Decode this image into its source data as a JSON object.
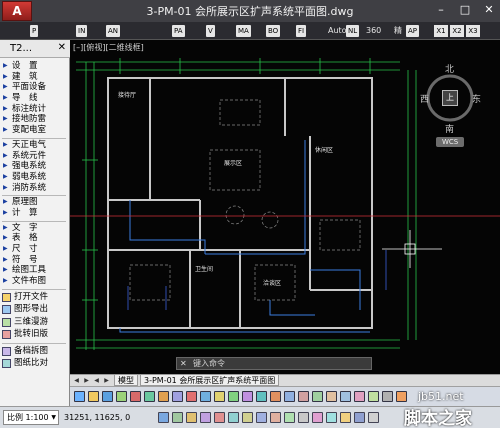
{
  "titlebar": {
    "title": "3-PM-01 会所展示区扩声系统平面图.dwg",
    "minimize": "–",
    "restore": "□",
    "close": "✕",
    "logo": "A"
  },
  "ribbon": {
    "items": [
      "P",
      "IN",
      "AN",
      "PA",
      "V",
      "MA",
      "BO",
      "FI"
    ],
    "auto_label": "Auto",
    "nl_tag": "NL",
    "deg": "360",
    "jing": "精",
    "ap_tag": "AP",
    "x1": "X1",
    "x2": "X2",
    "x3": "X3"
  },
  "panel": {
    "title": "T2...",
    "close": "✕",
    "group1": [
      "设　置",
      "建　筑",
      "平面设备",
      "导　线",
      "标注统计",
      "接地防雷",
      "变配电室"
    ],
    "group2": [
      "天正电气",
      "系统元件",
      "强电系统",
      "弱电系统",
      "消防系统"
    ],
    "group3": [
      "原理图",
      "计　算"
    ],
    "group4": [
      "文　字",
      "表　格",
      "尺　寸",
      "符　号",
      "绘图工具",
      "文件布图"
    ],
    "group5": [
      "打开文件",
      "图形导出",
      "三维漫游",
      "批转旧版"
    ],
    "group6": [
      "备档拆图",
      "图纸比对"
    ]
  },
  "canvas": {
    "view_label": "[–][俯视][二维线框]",
    "compass": {
      "north": "北",
      "south": "南",
      "west": "西",
      "east": "东",
      "center": "上"
    },
    "wcs": "WCS",
    "room_labels": [
      "接待厅",
      "展示区",
      "休闲区",
      "卫生间",
      "洽谈区"
    ]
  },
  "command": {
    "close": "✕",
    "placeholder": "键入命令"
  },
  "layout_tabs": {
    "nav": [
      "◀",
      "▶",
      "◀",
      "▶"
    ],
    "tabs": [
      "模型",
      "3-PM-01 会所展示区扩声系统平面图"
    ]
  },
  "statusbar": {
    "scale": "比例 1:100",
    "coords": "31251, 11625, 0"
  },
  "watermark": {
    "site": "jb51.net",
    "name": "脚本之家"
  }
}
